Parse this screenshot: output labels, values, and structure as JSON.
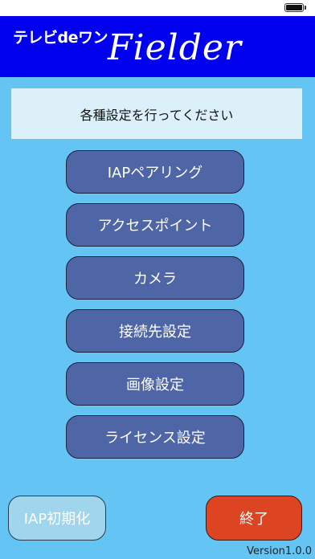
{
  "header": {
    "brand_jp": "テレビdeワン",
    "brand_en": "Fielder"
  },
  "message": "各種設定を行ってください",
  "menu": [
    {
      "label": "IAPペアリング"
    },
    {
      "label": "アクセスポイント"
    },
    {
      "label": "カメラ"
    },
    {
      "label": "接続先設定"
    },
    {
      "label": "画像設定"
    },
    {
      "label": "ライセンス設定"
    }
  ],
  "footer": {
    "iap_reset_label": "IAP初期化",
    "exit_label": "終了",
    "version": "Version1.0.0"
  },
  "colors": {
    "background": "#64c4f4",
    "header": "#0000ee",
    "menu_button": "#4f66a6",
    "exit_button": "#dd4422",
    "iap_reset_button": "#9fd6ee"
  },
  "icons": [
    "battery-icon"
  ]
}
